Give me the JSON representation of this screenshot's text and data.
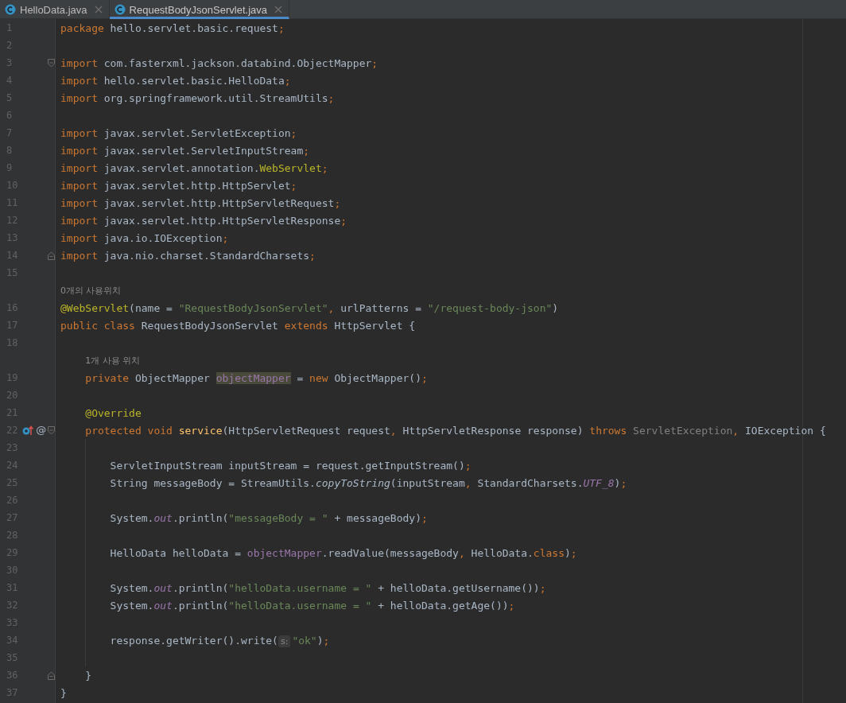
{
  "tabs": [
    {
      "label": "HelloData.java",
      "selected": false
    },
    {
      "label": "RequestBodyJsonServlet.java",
      "selected": true
    }
  ],
  "lines": [
    {
      "number": "1",
      "tokens": [
        {
          "text": "package",
          "kind": "keyword"
        },
        {
          "text": " hello.servlet.basic.request",
          "kind": "plain"
        },
        {
          "text": ";",
          "kind": "punct"
        }
      ]
    },
    {
      "number": "2"
    },
    {
      "number": "3",
      "fold_start": true,
      "tokens": [
        {
          "text": "import",
          "kind": "keyword"
        },
        {
          "text": " com.fasterxml.jackson.databind.ObjectMapper",
          "kind": "plain"
        },
        {
          "text": ";",
          "kind": "punct"
        }
      ]
    },
    {
      "number": "4",
      "tokens": [
        {
          "text": "import",
          "kind": "keyword"
        },
        {
          "text": " hello.servlet.basic.HelloData",
          "kind": "plain"
        },
        {
          "text": ";",
          "kind": "punct"
        }
      ]
    },
    {
      "number": "5",
      "tokens": [
        {
          "text": "import",
          "kind": "keyword"
        },
        {
          "text": " org.springframework.util.StreamUtils",
          "kind": "plain"
        },
        {
          "text": ";",
          "kind": "punct"
        }
      ]
    },
    {
      "number": "6"
    },
    {
      "number": "7",
      "tokens": [
        {
          "text": "import",
          "kind": "keyword"
        },
        {
          "text": " javax.servlet.ServletException",
          "kind": "plain"
        },
        {
          "text": ";",
          "kind": "punct"
        }
      ]
    },
    {
      "number": "8",
      "tokens": [
        {
          "text": "import",
          "kind": "keyword"
        },
        {
          "text": " javax.servlet.ServletInputStream",
          "kind": "plain"
        },
        {
          "text": ";",
          "kind": "punct"
        }
      ]
    },
    {
      "number": "9",
      "tokens": [
        {
          "text": "import",
          "kind": "keyword"
        },
        {
          "text": " javax.servlet.annotation.",
          "kind": "plain"
        },
        {
          "text": "WebServlet",
          "kind": "annotation"
        },
        {
          "text": ";",
          "kind": "punct"
        }
      ]
    },
    {
      "number": "10",
      "tokens": [
        {
          "text": "import",
          "kind": "keyword"
        },
        {
          "text": " javax.servlet.http.HttpServlet",
          "kind": "plain"
        },
        {
          "text": ";",
          "kind": "punct"
        }
      ]
    },
    {
      "number": "11",
      "tokens": [
        {
          "text": "import",
          "kind": "keyword"
        },
        {
          "text": " javax.servlet.http.HttpServletRequest",
          "kind": "plain"
        },
        {
          "text": ";",
          "kind": "punct"
        }
      ]
    },
    {
      "number": "12",
      "tokens": [
        {
          "text": "import",
          "kind": "keyword"
        },
        {
          "text": " javax.servlet.http.HttpServletResponse",
          "kind": "plain"
        },
        {
          "text": ";",
          "kind": "punct"
        }
      ]
    },
    {
      "number": "13",
      "tokens": [
        {
          "text": "import",
          "kind": "keyword"
        },
        {
          "text": " java.io.IOException",
          "kind": "plain"
        },
        {
          "text": ";",
          "kind": "punct"
        }
      ]
    },
    {
      "number": "14",
      "fold_end": true,
      "tokens": [
        {
          "text": "import",
          "kind": "keyword"
        },
        {
          "text": " java.nio.charset.StandardCharsets",
          "kind": "plain"
        },
        {
          "text": ";",
          "kind": "punct"
        }
      ]
    },
    {
      "number": "15"
    },
    {
      "kind": "usage-hint",
      "text": "0개의 사용위치"
    },
    {
      "number": "16",
      "tokens": [
        {
          "text": "@WebServlet",
          "kind": "annotation"
        },
        {
          "text": "(name = ",
          "kind": "plain"
        },
        {
          "text": "\"RequestBodyJsonServlet\"",
          "kind": "string"
        },
        {
          "text": ",",
          "kind": "punct"
        },
        {
          "text": " urlPatterns = ",
          "kind": "plain"
        },
        {
          "text": "\"/request-body-json\"",
          "kind": "string"
        },
        {
          "text": ")",
          "kind": "plain"
        }
      ]
    },
    {
      "number": "17",
      "tokens": [
        {
          "text": "public class",
          "kind": "keyword"
        },
        {
          "text": " RequestBodyJsonServlet ",
          "kind": "plain"
        },
        {
          "text": "extends",
          "kind": "keyword"
        },
        {
          "text": " HttpServlet {",
          "kind": "plain"
        }
      ]
    },
    {
      "number": "18"
    },
    {
      "kind": "usage-hint",
      "text": "1개 사용 위치"
    },
    {
      "number": "19",
      "tokens": [
        {
          "text": "    private",
          "kind": "keyword"
        },
        {
          "text": " ObjectMapper ",
          "kind": "plain"
        },
        {
          "text": "objectMapper",
          "kind": "field",
          "highlighted": true
        },
        {
          "text": " = ",
          "kind": "plain"
        },
        {
          "text": "new",
          "kind": "keyword"
        },
        {
          "text": " ObjectMapper()",
          "kind": "plain"
        },
        {
          "text": ";",
          "kind": "punct"
        }
      ]
    },
    {
      "number": "20"
    },
    {
      "number": "21",
      "tokens": [
        {
          "text": "    @Override",
          "kind": "annotation"
        }
      ]
    },
    {
      "number": "22",
      "fold_start": true,
      "gutter": [
        {
          "kind": "overrides"
        },
        {
          "kind": "glyph",
          "text": "@"
        }
      ],
      "tokens": [
        {
          "text": "    protected void ",
          "kind": "keyword"
        },
        {
          "text": "service",
          "kind": "declaration"
        },
        {
          "text": "(HttpServletRequest request",
          "kind": "plain"
        },
        {
          "text": ",",
          "kind": "punct"
        },
        {
          "text": " HttpServletResponse response) ",
          "kind": "plain"
        },
        {
          "text": "throws",
          "kind": "keyword"
        },
        {
          "text": " ServletException",
          "kind": "muted"
        },
        {
          "text": ",",
          "kind": "punct"
        },
        {
          "text": " IOException {",
          "kind": "plain"
        }
      ]
    },
    {
      "number": "23"
    },
    {
      "number": "24",
      "tokens": [
        {
          "text": "        ServletInputStream inputStream = request.getInputStream()",
          "kind": "plain"
        },
        {
          "text": ";",
          "kind": "punct"
        }
      ]
    },
    {
      "number": "25",
      "tokens": [
        {
          "text": "        String messageBody = StreamUtils.",
          "kind": "plain"
        },
        {
          "text": "copyToString",
          "kind": "staticcall"
        },
        {
          "text": "(inputStream",
          "kind": "plain"
        },
        {
          "text": ",",
          "kind": "punct"
        },
        {
          "text": " StandardCharsets.",
          "kind": "plain"
        },
        {
          "text": "UTF_8",
          "kind": "static"
        },
        {
          "text": ")",
          "kind": "plain"
        },
        {
          "text": ";",
          "kind": "punct"
        }
      ]
    },
    {
      "number": "26"
    },
    {
      "number": "27",
      "tokens": [
        {
          "text": "        System.",
          "kind": "plain"
        },
        {
          "text": "out",
          "kind": "static"
        },
        {
          "text": ".println(",
          "kind": "plain"
        },
        {
          "text": "\"messageBody = \"",
          "kind": "string"
        },
        {
          "text": " + messageBody)",
          "kind": "plain"
        },
        {
          "text": ";",
          "kind": "punct"
        }
      ]
    },
    {
      "number": "28"
    },
    {
      "number": "29",
      "tokens": [
        {
          "text": "        HelloData helloData = ",
          "kind": "plain"
        },
        {
          "text": "objectMapper",
          "kind": "field"
        },
        {
          "text": ".readValue(messageBody",
          "kind": "plain"
        },
        {
          "text": ",",
          "kind": "punct"
        },
        {
          "text": " HelloData.",
          "kind": "plain"
        },
        {
          "text": "class",
          "kind": "keyword"
        },
        {
          "text": ")",
          "kind": "plain"
        },
        {
          "text": ";",
          "kind": "punct"
        }
      ]
    },
    {
      "number": "30"
    },
    {
      "number": "31",
      "tokens": [
        {
          "text": "        System.",
          "kind": "plain"
        },
        {
          "text": "out",
          "kind": "static"
        },
        {
          "text": ".println(",
          "kind": "plain"
        },
        {
          "text": "\"helloData.username = \"",
          "kind": "string"
        },
        {
          "text": " + helloData.getUsername())",
          "kind": "plain"
        },
        {
          "text": ";",
          "kind": "punct"
        }
      ]
    },
    {
      "number": "32",
      "tokens": [
        {
          "text": "        System.",
          "kind": "plain"
        },
        {
          "text": "out",
          "kind": "static"
        },
        {
          "text": ".println(",
          "kind": "plain"
        },
        {
          "text": "\"helloData.username = \"",
          "kind": "string"
        },
        {
          "text": " + helloData.getAge())",
          "kind": "plain"
        },
        {
          "text": ";",
          "kind": "punct"
        }
      ]
    },
    {
      "number": "33"
    },
    {
      "number": "34",
      "tokens": [
        {
          "text": "        response.getWriter().write(",
          "kind": "plain"
        },
        {
          "text": "s:",
          "kind": "paramhint"
        },
        {
          "text": "\"ok\"",
          "kind": "string"
        },
        {
          "text": ")",
          "kind": "plain"
        },
        {
          "text": ";",
          "kind": "punct"
        }
      ]
    },
    {
      "number": "35"
    },
    {
      "number": "36",
      "fold_end": true,
      "tokens": [
        {
          "text": "    }",
          "kind": "plain"
        }
      ]
    },
    {
      "number": "37",
      "tokens": [
        {
          "text": "}",
          "kind": "plain"
        }
      ]
    }
  ]
}
